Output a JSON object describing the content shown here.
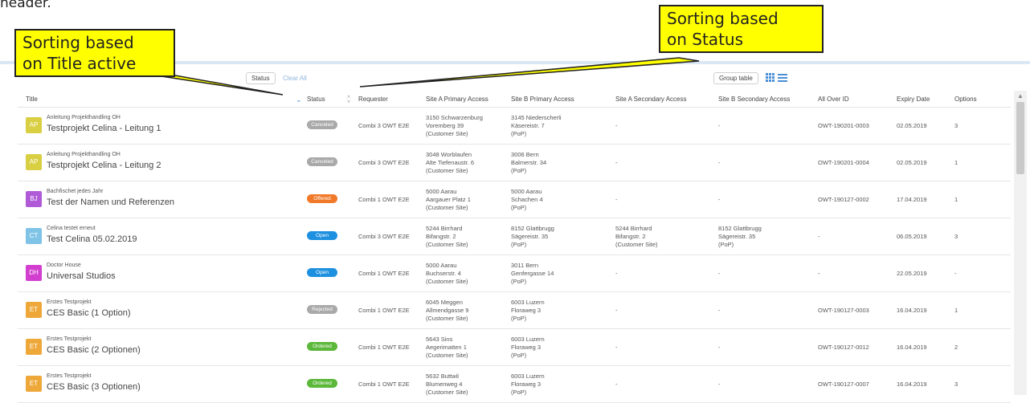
{
  "fragment": "header.",
  "annotations": {
    "title_sort": "Sorting based\non Title active",
    "status_sort": "Sorting based\non Status"
  },
  "toolbar": {
    "status_filter": "Status",
    "clear_all": "Clear All",
    "group_table": "Group table"
  },
  "columns": [
    "Title",
    "Status",
    "Requester",
    "Site A Primary Access",
    "Site B Primary Access",
    "Site A Secondary Access",
    "Site B Secondary Access",
    "All Over ID",
    "Expiry Date",
    "Options"
  ],
  "rows": [
    {
      "initials": "AP",
      "color": "#d9cf43",
      "subtitle": "Anleitung Projekthandling OH",
      "title": "Testprojekt Celina - Leitung 1",
      "status": "Canceled",
      "status_color": "#a9a9a9",
      "requester": "Combi 3 OWT E2E",
      "siteA": [
        "3150 Schwarzenburg",
        "Voremberg 39",
        "(Customer Site)"
      ],
      "siteB": [
        "3145 Niederscherli",
        "Käsereistr. 7",
        "(PoP)"
      ],
      "siteA2": [
        "-"
      ],
      "siteB2": [
        "-"
      ],
      "id": "OWT-190201-0003",
      "expiry": "02.05.2019",
      "options": "3"
    },
    {
      "initials": "AP",
      "color": "#d9cf43",
      "subtitle": "Anleitung Projekthandling OH",
      "title": "Testprojekt Celina - Leitung 2",
      "status": "Canceled",
      "status_color": "#a9a9a9",
      "requester": "Combi 3 OWT E2E",
      "siteA": [
        "3048 Worblaufen",
        "Alte Tiefenaustr. 6",
        "(Customer Site)"
      ],
      "siteB": [
        "3006 Bern",
        "Balmerstr. 34",
        "(PoP)"
      ],
      "siteA2": [
        "-"
      ],
      "siteB2": [
        "-"
      ],
      "id": "OWT-190201-0004",
      "expiry": "02.05.2019",
      "options": "1"
    },
    {
      "initials": "BJ",
      "color": "#b05ad8",
      "subtitle": "Bachfischet jedes Jahr",
      "title": "Test der Namen und Referenzen",
      "status": "Offered",
      "status_color": "#f07a2a",
      "requester": "Combi 1 OWT E2E",
      "siteA": [
        "5000 Aarau",
        "Aargauer Platz 1",
        "(Customer Site)"
      ],
      "siteB": [
        "5000 Aarau",
        "Schachen 4",
        "(PoP)"
      ],
      "siteA2": [
        "-"
      ],
      "siteB2": [
        "-"
      ],
      "id": "OWT-190127-0002",
      "expiry": "17.04.2019",
      "options": "1"
    },
    {
      "initials": "CT",
      "color": "#7fc3e6",
      "subtitle": "Celina testet erneut",
      "title": "Test Celina 05.02.2019",
      "status": "Open",
      "status_color": "#1e90e0",
      "requester": "Combi 3 OWT E2E",
      "siteA": [
        "5244 Birrhard",
        "Bifangstr. 2",
        "(Customer Site)"
      ],
      "siteB": [
        "8152 Glattbrugg",
        "Sägereistr. 35",
        "(PoP)"
      ],
      "siteA2": [
        "5244 Birrhard",
        "Bifangstr. 2",
        "(Customer Site)"
      ],
      "siteB2": [
        "8152 Glattbrugg",
        "Sägereistr. 35",
        "(PoP)"
      ],
      "id": "-",
      "expiry": "06.05.2019",
      "options": "3"
    },
    {
      "initials": "DH",
      "color": "#d23fcf",
      "subtitle": "Doctor House",
      "title": "Universal Studios",
      "status": "Open",
      "status_color": "#1e90e0",
      "requester": "Combi 1 OWT E2E",
      "siteA": [
        "5000 Aarau",
        "Buchserstr. 4",
        "(Customer Site)"
      ],
      "siteB": [
        "3011 Bern",
        "Genfergasse 14",
        "(PoP)"
      ],
      "siteA2": [
        "-"
      ],
      "siteB2": [
        "-"
      ],
      "id": "-",
      "expiry": "22.05.2019",
      "options": "-"
    },
    {
      "initials": "ET",
      "color": "#eea83a",
      "subtitle": "Erstes Testprojekt",
      "title": "CES Basic (1 Option)",
      "status": "Rejected",
      "status_color": "#a9a9a9",
      "requester": "Combi 1 OWT E2E",
      "siteA": [
        "6045 Meggen",
        "Allmendgasse 9",
        "(Customer Site)"
      ],
      "siteB": [
        "6003 Luzern",
        "Floraweg 3",
        "(PoP)"
      ],
      "siteA2": [
        "-"
      ],
      "siteB2": [
        "-"
      ],
      "id": "OWT-190127-0003",
      "expiry": "16.04.2019",
      "options": "1"
    },
    {
      "initials": "ET",
      "color": "#eea83a",
      "subtitle": "Erstes Testprojekt",
      "title": "CES Basic (2 Optionen)",
      "status": "Ordered",
      "status_color": "#5cb83a",
      "requester": "Combi 1 OWT E2E",
      "siteA": [
        "5643 Sins",
        "Aegerimatten 1",
        "(Customer Site)"
      ],
      "siteB": [
        "6003 Luzern",
        "Floraweg 3",
        "(PoP)"
      ],
      "siteA2": [
        "-"
      ],
      "siteB2": [
        "-"
      ],
      "id": "OWT-190127-0012",
      "expiry": "16.04.2019",
      "options": "2"
    },
    {
      "initials": "ET",
      "color": "#eea83a",
      "subtitle": "Erstes Testprojekt",
      "title": "CES Basic (3 Optionen)",
      "status": "Ordered",
      "status_color": "#5cb83a",
      "requester": "Combi 1 OWT E2E",
      "siteA": [
        "5632 Buttwil",
        "Blumenweg 4",
        "(Customer Site)"
      ],
      "siteB": [
        "6003 Luzern",
        "Floraweg 3",
        "(PoP)"
      ],
      "siteA2": [
        "-"
      ],
      "siteB2": [
        "-"
      ],
      "id": "OWT-190127-0007",
      "expiry": "16.04.2019",
      "options": "3"
    }
  ]
}
